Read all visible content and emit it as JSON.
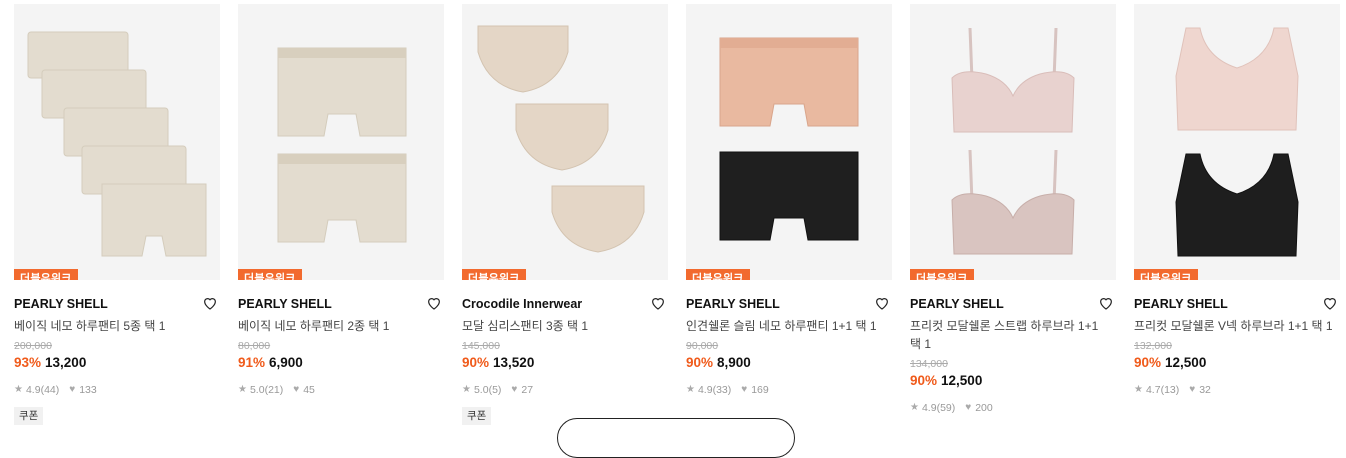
{
  "products": [
    {
      "tag": "더블유위크",
      "brand": "PEARLY SHELL",
      "title": "베이직 네모 하루팬티 5종 택 1",
      "original_price": "200,000",
      "discount": "93%",
      "price": "13,200",
      "rating": "4.9",
      "reviews": "(44)",
      "likes": "133",
      "coupon": "쿠폰",
      "image": "five-beige-boxer-briefs"
    },
    {
      "tag": "더블유위크",
      "brand": "PEARLY SHELL",
      "title": "베이직 네모 하루팬티 2종 택 1",
      "original_price": "80,000",
      "discount": "91%",
      "price": "6,900",
      "rating": "5.0",
      "reviews": "(21)",
      "likes": "45",
      "coupon": "",
      "image": "two-beige-boxer-briefs"
    },
    {
      "tag": "더블유위크",
      "brand": "Crocodile Innerwear",
      "title": "모달 심리스팬티 3종 택 1",
      "original_price": "145,000",
      "discount": "90%",
      "price": "13,520",
      "rating": "5.0",
      "reviews": "(5)",
      "likes": "27",
      "coupon": "쿠폰",
      "image": "three-beige-briefs"
    },
    {
      "tag": "더블유위크",
      "brand": "PEARLY SHELL",
      "title": "인견쉘론 슬림 네모 하루팬티 1+1 택 1",
      "original_price": "90,000",
      "discount": "90%",
      "price": "8,900",
      "rating": "4.9",
      "reviews": "(33)",
      "likes": "169",
      "coupon": "",
      "image": "peach-and-black-boxer-briefs"
    },
    {
      "tag": "더블유위크",
      "brand": "PEARLY SHELL",
      "title": "프리컷 모달쉘론 스트랩 하루브라 1+1 택 1",
      "original_price": "134,000",
      "discount": "90%",
      "price": "12,500",
      "rating": "4.9",
      "reviews": "(59)",
      "likes": "200",
      "coupon": "",
      "image": "two-pink-strap-bras"
    },
    {
      "tag": "더블유위크",
      "brand": "PEARLY SHELL",
      "title": "프리컷 모달쉘론 V넥 하루브라 1+1 택 1",
      "original_price": "132,000",
      "discount": "90%",
      "price": "12,500",
      "rating": "4.7",
      "reviews": "(13)",
      "likes": "32",
      "coupon": "",
      "image": "pink-and-black-vneck-bras"
    }
  ],
  "colors": {
    "tag_bg": "#f26a2e",
    "discount": "#f05a1a",
    "thumb_bg": "#f4f4f4"
  },
  "icons": {
    "wishlist": "heart-outline-icon",
    "rating": "star-icon",
    "likes": "heart-filled-icon"
  }
}
